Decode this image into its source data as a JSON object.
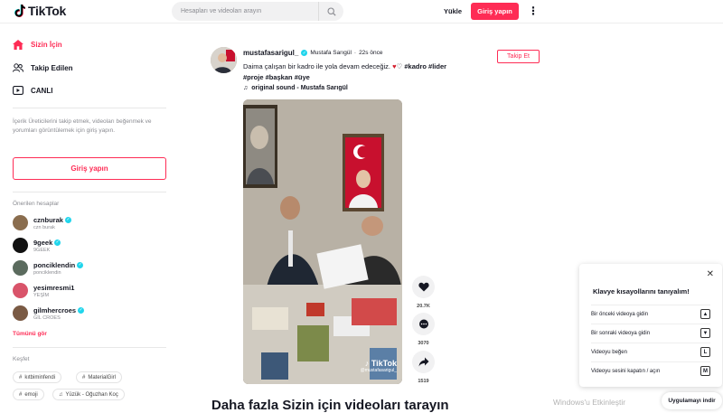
{
  "header": {
    "logo_text": "TikTok",
    "search_placeholder": "Hesapları ve videoları arayın",
    "upload_label": "Yükle",
    "login_label": "Giriş yapın"
  },
  "sidebar": {
    "nav": [
      {
        "label": "Sizin İçin",
        "icon": "home-icon",
        "active": true
      },
      {
        "label": "Takip Edilen",
        "icon": "following-icon",
        "active": false
      },
      {
        "label": "CANLI",
        "icon": "live-icon",
        "active": false
      }
    ],
    "info_text": "İçerik Üreticilerini takip etmek, videoları beğenmek ve yorumları görüntülemek için giriş yapın.",
    "login_label": "Giriş yapın",
    "suggested_title": "Önerilen hesaplar",
    "accounts": [
      {
        "name": "cznburak",
        "sub": "czn burak",
        "color": "#8a6d4e"
      },
      {
        "name": "9geek",
        "sub": "9GEEK",
        "color": "#111111"
      },
      {
        "name": "ponciklendin",
        "sub": "ponciklendin",
        "color": "#5b6b5e"
      },
      {
        "name": "yesimresmi1",
        "sub": "YEŞİM",
        "color": "#d9546a"
      },
      {
        "name": "gilmhercroes",
        "sub": "GİL CROES",
        "color": "#7a5a44"
      }
    ],
    "see_all_label": "Tümünü gör",
    "discover_title": "Keşfet",
    "tags": [
      {
        "label": "kıtbiminfendi",
        "type": "hashtag"
      },
      {
        "label": "MaterialGirl",
        "type": "hashtag"
      },
      {
        "label": "emoji",
        "type": "hashtag"
      },
      {
        "label": "Yüzük - Oğuzhan Koç",
        "type": "music"
      }
    ]
  },
  "post": {
    "username": "mustafasarigul_",
    "display_name": "Mustafa Sarıgül",
    "time_ago": "22s önce",
    "follow_label": "Takip Et",
    "caption_text": "Daima çalışan bir kadro ile yola devam edeceğiz.",
    "hashtags_line1": "#kadro #lider",
    "hashtags_line2": "#proje #başkan #üye",
    "sound": "original sound - Mustafa Sarıgül",
    "video_watermark_brand": "TikTok",
    "video_watermark_user": "@mustafasarigul_",
    "likes": "20.7K",
    "comments": "3070",
    "shares": "1519"
  },
  "bottom_heading": "Daha fazla Sizin için videoları tarayın",
  "keyboard_panel": {
    "title": "Klavye kısayollarını tanıyalım!",
    "rows": [
      {
        "label": "Bir önceki videoya gidin",
        "key": "▲"
      },
      {
        "label": "Bir sonraki videoya gidin",
        "key": "▼"
      },
      {
        "label": "Videoyu beğen",
        "key": "L"
      },
      {
        "label": "Videoyu sesini kapatın / açın",
        "key": "M"
      }
    ]
  },
  "windows_watermark": "Windows'u Etkinleştir",
  "get_app_label": "Uygulamayı indir",
  "colors": {
    "accent": "#fe2c55",
    "verified": "#20d5ec"
  }
}
